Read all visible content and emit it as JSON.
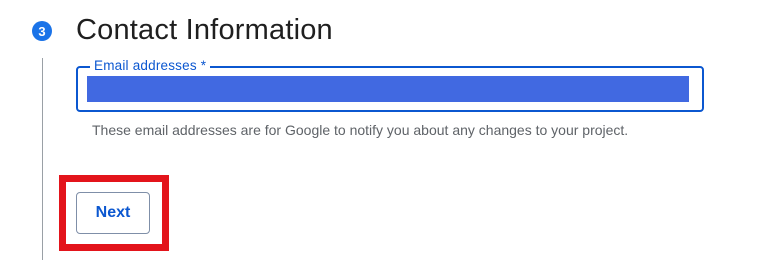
{
  "step": {
    "number": "3",
    "title": "Contact Information"
  },
  "email_field": {
    "label": "Email addresses *",
    "value": "",
    "state": "focused, text selected"
  },
  "helper_text": "These email addresses are for Google to notify you about any changes to your project.",
  "next_button": {
    "label": "Next"
  },
  "colors": {
    "accent": "#0b57d0",
    "badge": "#1a73e8",
    "selection": "#4169e1",
    "title_text": "#1f1f1f",
    "helper_text": "#5f6368",
    "step_line": "#9aa0a6",
    "highlight_border": "#e3141b"
  }
}
